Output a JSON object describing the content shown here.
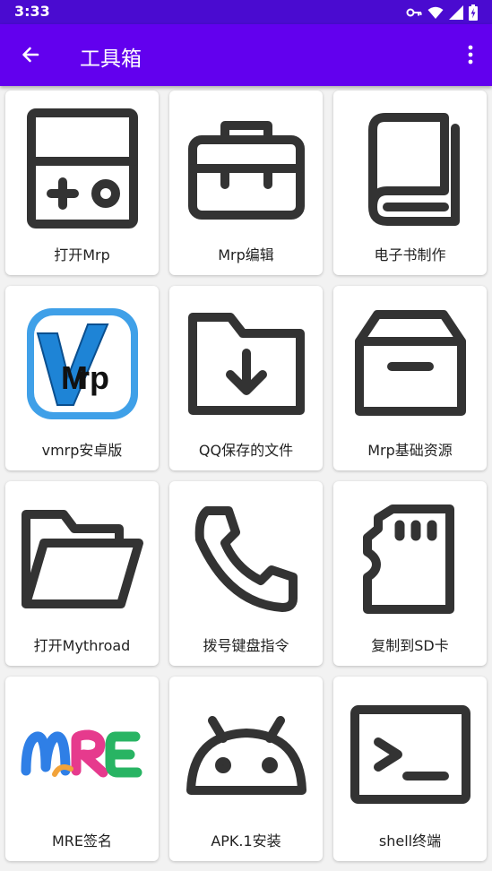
{
  "status_bar": {
    "time": "3:33",
    "icons": [
      "key-icon",
      "wifi-icon",
      "signal-icon",
      "battery-charging-icon"
    ]
  },
  "app_bar": {
    "title": "工具箱",
    "back_icon": "arrow-back-icon",
    "menu_icon": "more-vertical-icon",
    "background": "#6200ee"
  },
  "tools": [
    {
      "label": "打开Mrp",
      "icon": "gamepad-icon"
    },
    {
      "label": "Mrp编辑",
      "icon": "toolbox-icon"
    },
    {
      "label": "电子书制作",
      "icon": "book-icon"
    },
    {
      "label": "vmrp安卓版",
      "icon": "vmrp-logo-icon"
    },
    {
      "label": "QQ保存的文件",
      "icon": "folder-download-icon"
    },
    {
      "label": "Mrp基础资源",
      "icon": "archive-box-icon"
    },
    {
      "label": "打开Mythroad",
      "icon": "folder-open-icon"
    },
    {
      "label": "拨号键盘指令",
      "icon": "phone-icon"
    },
    {
      "label": "复制到SD卡",
      "icon": "sd-card-icon"
    },
    {
      "label": "MRE签名",
      "icon": "mre-logo-icon"
    },
    {
      "label": "APK.1安装",
      "icon": "android-icon"
    },
    {
      "label": "shell终端",
      "icon": "terminal-icon"
    }
  ]
}
